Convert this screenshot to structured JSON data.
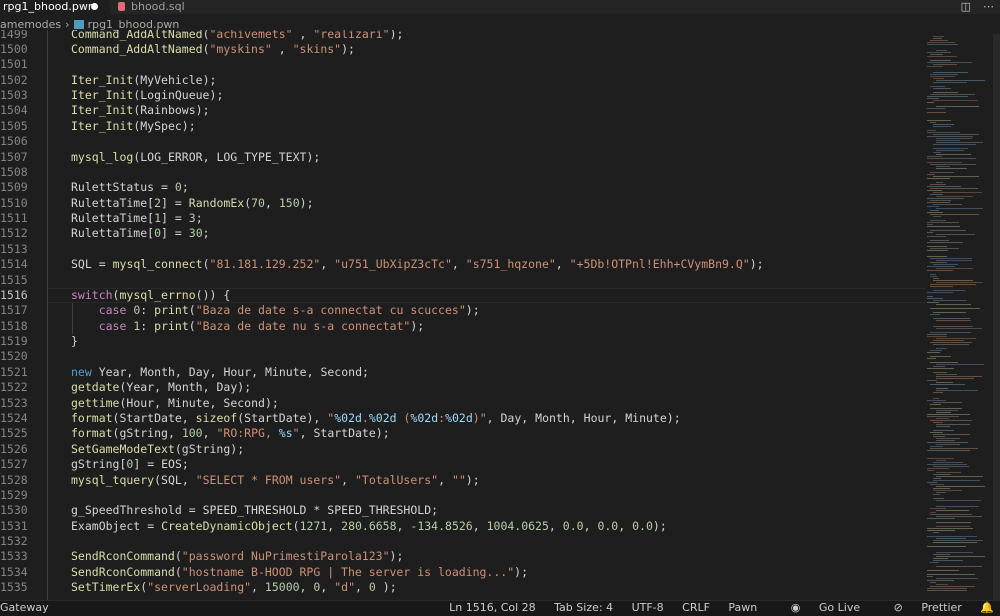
{
  "tabs": [
    {
      "label": "rpg1_bhood.pwn",
      "active": true,
      "modified": true
    },
    {
      "label": "bhood.sql",
      "active": false
    }
  ],
  "breadcrumb": [
    "amemodes",
    "rpg1_bhood.pwn"
  ],
  "editor": {
    "cursor_line": 1516,
    "lines": [
      {
        "n": "1499",
        "code": "    Command_AddAltNamed(\"achivemets\" , \"realizari\");"
      },
      {
        "n": "1500",
        "code": "    Command_AddAltNamed(\"myskins\" , \"skins\");"
      },
      {
        "n": "1501",
        "code": ""
      },
      {
        "n": "1502",
        "code": "    Iter_Init(MyVehicle);"
      },
      {
        "n": "1503",
        "code": "    Iter_Init(LoginQueue);"
      },
      {
        "n": "1504",
        "code": "    Iter_Init(Rainbows);"
      },
      {
        "n": "1505",
        "code": "    Iter_Init(MySpec);"
      },
      {
        "n": "1506",
        "code": ""
      },
      {
        "n": "1507",
        "code": "    mysql_log(LOG_ERROR, LOG_TYPE_TEXT);"
      },
      {
        "n": "1508",
        "code": ""
      },
      {
        "n": "1509",
        "code": "    RulettStatus = 0;"
      },
      {
        "n": "1510",
        "code": "    RulettaTime[2] = RandomEx(70, 150);"
      },
      {
        "n": "1511",
        "code": "    RulettaTime[1] = 3;"
      },
      {
        "n": "1512",
        "code": "    RulettaTime[0] = 30;"
      },
      {
        "n": "1513",
        "code": ""
      },
      {
        "n": "1514",
        "code": "    SQL = mysql_connect(\"81.181.129.252\", \"u751_UbXipZ3cTc\", \"s751_hqzone\", \"+5Db!OTPnl!Ehh+CVymBn9.Q\");"
      },
      {
        "n": "1515",
        "code": ""
      },
      {
        "n": "1516",
        "code": "    switch(mysql_errno()) {"
      },
      {
        "n": "1517",
        "code": "        case 0: print(\"Baza de date s-a connectat cu scucces\");"
      },
      {
        "n": "1518",
        "code": "        case 1: print(\"Baza de date nu s-a connectat\");"
      },
      {
        "n": "1519",
        "code": "    }"
      },
      {
        "n": "1520",
        "code": ""
      },
      {
        "n": "1521",
        "code": "    new Year, Month, Day, Hour, Minute, Second;"
      },
      {
        "n": "1522",
        "code": "    getdate(Year, Month, Day);"
      },
      {
        "n": "1523",
        "code": "    gettime(Hour, Minute, Second);"
      },
      {
        "n": "1524",
        "code": "    format(StartDate, sizeof(StartDate), \"%02d.%02d (%02d:%02d)\", Day, Month, Hour, Minute);"
      },
      {
        "n": "1525",
        "code": "    format(gString, 100, \"RO:RPG, %s\", StartDate);"
      },
      {
        "n": "1526",
        "code": "    SetGameModeText(gString);"
      },
      {
        "n": "1527",
        "code": "    gString[0] = EOS;"
      },
      {
        "n": "1528",
        "code": "    mysql_tquery(SQL, \"SELECT * FROM users\", \"TotalUsers\", \"\");"
      },
      {
        "n": "1529",
        "code": ""
      },
      {
        "n": "1530",
        "code": "    g_SpeedThreshold = SPEED_THRESHOLD * SPEED_THRESHOLD;"
      },
      {
        "n": "1531",
        "code": "    ExamObject = CreateDynamicObject(1271, 280.6658, -134.8526, 1004.0625, 0.0, 0.0, 0.0);"
      },
      {
        "n": "1532",
        "code": ""
      },
      {
        "n": "1533",
        "code": "    SendRconCommand(\"password NuPrimestiParola123\");"
      },
      {
        "n": "1534",
        "code": "    SendRconCommand(\"hostname B-HOOD RPG | The server is loading...\");"
      },
      {
        "n": "1535",
        "code": "    SetTimerEx(\"serverLoading\", 15000, 0, \"d\", 0 );"
      }
    ]
  },
  "statusbar": {
    "left": "Gateway",
    "position": "Ln 1516, Col 28",
    "tab_size": "Tab Size: 4",
    "encoding": "UTF-8",
    "eol": "CRLF",
    "language": "Pawn",
    "go_live": "Go Live",
    "prettier": "Prettier"
  },
  "colors": {
    "editor_bg": "#1e1e1e",
    "function": "#dcdcaa",
    "string": "#ce9178",
    "number": "#b5cea8",
    "keyword": "#569cd6",
    "control": "#c586c0",
    "variable": "#9cdcfe",
    "text": "#d4d4d4",
    "line_number": "#858585"
  },
  "icons": [
    "sql-file-icon",
    "pawn-file-icon",
    "split-editor-icon",
    "more-actions-icon",
    "go-live-icon",
    "prettier-icon",
    "notification-bell-icon"
  ]
}
